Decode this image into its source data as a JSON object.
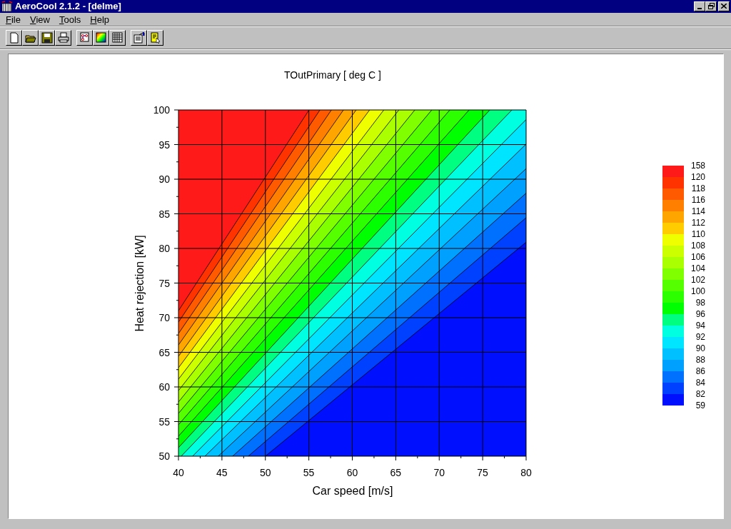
{
  "window": {
    "title": "AeroCool 2.1.2 - [delme]"
  },
  "menu": [
    {
      "label": "File"
    },
    {
      "label": "View"
    },
    {
      "label": "Tools"
    },
    {
      "label": "Help"
    }
  ],
  "plot": {
    "title": "TOutPrimary [ deg C ]",
    "x_axis": {
      "label": "Car speed [m/s]",
      "ticks": [
        "40",
        "45",
        "50",
        "55",
        "60",
        "65",
        "70",
        "75",
        "80"
      ]
    },
    "y_axis": {
      "label": "Heat rejection [kW]",
      "ticks": [
        "100",
        "95",
        "90",
        "85",
        "80",
        "75",
        "70",
        "65",
        "60",
        "55",
        "50"
      ]
    },
    "legend": {
      "labels": [
        "158",
        "120",
        "118",
        "116",
        "114",
        "112",
        "110",
        "108",
        "106",
        "104",
        "102",
        "100",
        "98",
        "96",
        "94",
        "92",
        "90",
        "88",
        "86",
        "84",
        "82",
        "59"
      ],
      "bands": [
        {
          "color": "#ff1a1a"
        },
        {
          "color": "#ff3300"
        },
        {
          "color": "#ff5a00"
        },
        {
          "color": "#ff8000"
        },
        {
          "color": "#ffa500"
        },
        {
          "color": "#ffcc00"
        },
        {
          "color": "#f0ff00"
        },
        {
          "color": "#ccff00"
        },
        {
          "color": "#aaff00"
        },
        {
          "color": "#80ff00"
        },
        {
          "color": "#55ff00"
        },
        {
          "color": "#2bff00"
        },
        {
          "color": "#00ff00"
        },
        {
          "color": "#00ff80"
        },
        {
          "color": "#00ffe0"
        },
        {
          "color": "#00e5ff"
        },
        {
          "color": "#00c0ff"
        },
        {
          "color": "#00a0ff"
        },
        {
          "color": "#0070ff"
        },
        {
          "color": "#0040ff"
        },
        {
          "color": "#0010ff"
        }
      ]
    }
  }
}
